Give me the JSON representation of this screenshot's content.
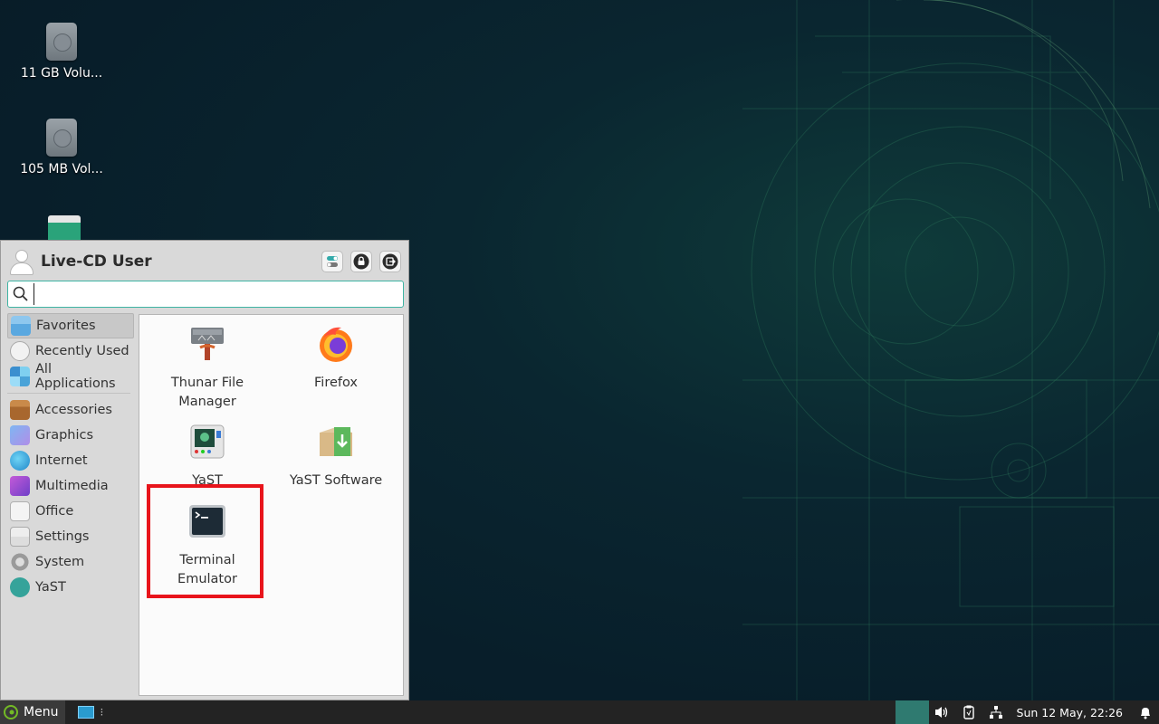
{
  "desktop": {
    "icons": [
      {
        "label": "11 GB Volu..."
      },
      {
        "label": "105 MB Vol..."
      },
      {
        "label": ""
      }
    ]
  },
  "menu": {
    "user_name": "Live-CD User",
    "search_placeholder": "",
    "categories_top": [
      {
        "label": "Favorites",
        "icon": "favorites-icon"
      },
      {
        "label": "Recently Used",
        "icon": "clock-icon"
      },
      {
        "label": "All Applications",
        "icon": "grid-icon"
      }
    ],
    "categories": [
      {
        "label": "Accessories",
        "icon": "briefcase-icon"
      },
      {
        "label": "Graphics",
        "icon": "graphics-icon"
      },
      {
        "label": "Internet",
        "icon": "globe-icon"
      },
      {
        "label": "Multimedia",
        "icon": "multimedia-icon"
      },
      {
        "label": "Office",
        "icon": "office-icon"
      },
      {
        "label": "Settings",
        "icon": "settings-icon"
      },
      {
        "label": "System",
        "icon": "gear-icon"
      },
      {
        "label": "YaST",
        "icon": "yast-icon"
      }
    ],
    "apps": [
      {
        "line1": "Thunar File",
        "line2": "Manager"
      },
      {
        "line1": "Firefox",
        "line2": ""
      },
      {
        "line1": "YaST",
        "line2": ""
      },
      {
        "line1": "YaST Software",
        "line2": ""
      },
      {
        "line1": "Terminal",
        "line2": "Emulator"
      }
    ]
  },
  "taskbar": {
    "menu_label": "Menu",
    "clock": "Sun 12 May, 22:26"
  }
}
